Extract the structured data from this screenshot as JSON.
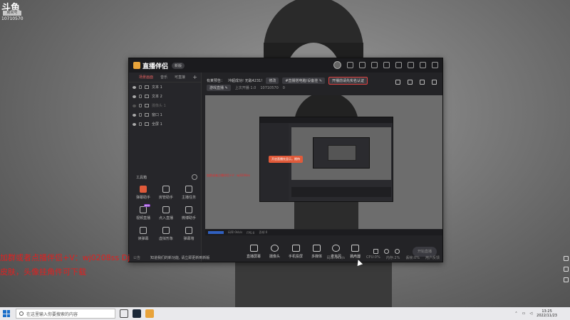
{
  "desktop": {
    "logo_mark": "斗鱼",
    "logo_tag": "房间号",
    "logo_room_number": "10710570",
    "overlay_line1": "加群或者点播伴侣+V：wj0208ss  Dj",
    "overlay_line2": "皮肤，头像挂角件可下载"
  },
  "app": {
    "name": "直播伴侣",
    "version": "新版",
    "sources_tabs": [
      "场景画面",
      "音乐",
      "可直接"
    ],
    "add_label": "+",
    "sources": [
      {
        "label": "文本 1",
        "visible": true
      },
      {
        "label": "文本 2",
        "visible": true
      },
      {
        "label": "摄像头 1",
        "visible": false
      },
      {
        "label": "窗口 1",
        "visible": true
      },
      {
        "label": "全屏 1",
        "visible": true
      }
    ],
    "tools_title": "工具箱",
    "tools": [
      {
        "label": "弹幕助手",
        "highlight": true,
        "badge": ""
      },
      {
        "label": "房管助手",
        "highlight": false,
        "badge": ""
      },
      {
        "label": "主播任务",
        "highlight": false,
        "badge": ""
      },
      {
        "label": "视频直播",
        "highlight": false,
        "badge": "NEW"
      },
      {
        "label": "点入直播",
        "highlight": false,
        "badge": ""
      },
      {
        "label": "微博助手",
        "highlight": false,
        "badge": ""
      },
      {
        "label": "读弹幕",
        "highlight": false,
        "badge": ""
      },
      {
        "label": "虚拟形象",
        "highlight": false,
        "badge": ""
      },
      {
        "label": "弹幕墙",
        "highlight": false,
        "badge": ""
      },
      {
        "label": "投屏",
        "highlight": false,
        "badge": ""
      },
      {
        "label": "连麦",
        "highlight": false,
        "badge": "NEW"
      },
      {
        "label": "录屏",
        "highlight": false,
        "badge": ""
      }
    ],
    "stream_title_prefix": "有某预告：",
    "stream_title": "冲超成功! 无敌4231!",
    "edit_chip": "修改",
    "category_chip": "#直播搭电脑/设备挂 ✎",
    "red_chip": "开播前请先实名认证",
    "tag_chip": "游戏直播 ✎",
    "last_live": "上次开播 1.0",
    "room_id": "10710570",
    "heat": "0",
    "nested_tip": "开启直播先显示，期待",
    "nested_red": "加群或者点播伴侣+V：wj0208ss",
    "status_items": [
      "码率:0kb/s",
      "FPS:0",
      "丢帧:0"
    ],
    "bottom_tools": [
      "直播屏幕",
      "摄像头",
      "手机投屏",
      "多媒体",
      "麦克风",
      "扬声器"
    ],
    "start_button": "开始直播",
    "footer_left": "公告",
    "footer_notice": "知道我们的新功能, 请立即更新到新版",
    "footer_stats": [
      "码率:0kb/s",
      "FPS:0",
      "CPU:0%",
      "内存:2%",
      "丢帧:0%",
      "用户反馈"
    ]
  },
  "taskbar": {
    "search_placeholder": "在这里输入你要搜索的内容",
    "time": "13:25",
    "date": "2022/11/23"
  }
}
